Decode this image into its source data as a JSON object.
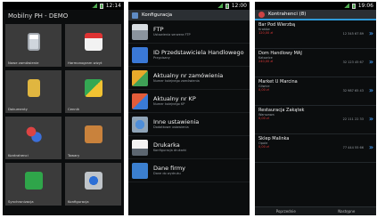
{
  "screen1": {
    "status_time": "12:14",
    "title": "Mobilny PH - DEMO",
    "tiles": [
      {
        "label": "Nowe zamówienie",
        "icon": "clipboard-icon"
      },
      {
        "label": "Harmonogram wizyt",
        "icon": "calendar-icon"
      },
      {
        "label": "Dokumenty",
        "icon": "folder-icon"
      },
      {
        "label": "Cennik",
        "icon": "price-list-icon"
      },
      {
        "label": "Kontrahenci",
        "icon": "contacts-icon"
      },
      {
        "label": "Towary",
        "icon": "package-icon"
      },
      {
        "label": "Synchronizacja",
        "icon": "sync-icon"
      },
      {
        "label": "Konfiguracja",
        "icon": "settings-icon"
      }
    ]
  },
  "screen2": {
    "status_time": "12:00",
    "title": "Konfiguracja",
    "items": [
      {
        "title": "FTP",
        "subtitle": "Ustawienia serwera FTP"
      },
      {
        "title": "ID Przedstawiciela Handlowego",
        "subtitle": "Przypisany"
      },
      {
        "title": "Aktualny nr zamówienia",
        "subtitle": "Numer kolejnego zamówienia"
      },
      {
        "title": "Aktualny nr KP",
        "subtitle": "Numer kolejnego KP"
      },
      {
        "title": "Inne ustawienia",
        "subtitle": "Dodatkowe ustawienia"
      },
      {
        "title": "Drukarka",
        "subtitle": "Konfiguracja drukarki"
      },
      {
        "title": "Dane firmy",
        "subtitle": "Dane do wydruku"
      }
    ]
  },
  "screen3": {
    "status_time": "19:06",
    "title": "Kontrahenci (8)",
    "contacts": [
      {
        "name": "Bar Pod Wierzbą",
        "city": "Kraków",
        "amount": "120,00 zł",
        "phone": "12 345 67 89"
      },
      {
        "name": "Dom Handlowy MAJ",
        "city": "Katowice",
        "amount": "240,00 zł",
        "phone": "32 123 45 67"
      },
      {
        "name": "Market U Marcina",
        "city": "Gliwice",
        "amount": "0,00 zł",
        "phone": "32 987 65 43"
      },
      {
        "name": "Restauracja Zakątek",
        "city": "Warszawa",
        "amount": "0,00 zł",
        "phone": "22 111 22 33"
      },
      {
        "name": "Sklep Malinka",
        "city": "Opole",
        "amount": "0,00 zł",
        "phone": "77 444 55 66"
      }
    ],
    "bottom_left": "Poprzednie",
    "bottom_right": "Następne"
  }
}
